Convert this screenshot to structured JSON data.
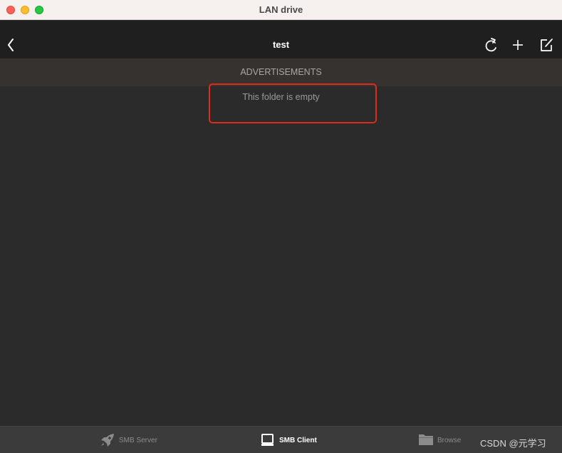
{
  "window": {
    "title": "LAN drive",
    "controls": [
      "close",
      "minimize",
      "maximize"
    ]
  },
  "navbar": {
    "title": "test",
    "back_icon": "chevron-left-icon",
    "actions": [
      {
        "name": "refresh",
        "icon": "refresh-icon"
      },
      {
        "name": "add",
        "icon": "plus-icon"
      },
      {
        "name": "edit",
        "icon": "compose-icon"
      }
    ]
  },
  "ad": {
    "label": "ADVERTISEMENTS"
  },
  "content": {
    "empty_message": "This folder is empty",
    "highlight_color": "#e02a1c"
  },
  "tabbar": {
    "tabs": [
      {
        "label": "SMB Server",
        "icon": "rocket-icon",
        "selected": false
      },
      {
        "label": "SMB Client",
        "icon": "monitor-icon",
        "selected": true
      },
      {
        "label": "Browse",
        "icon": "folder-icon",
        "selected": false
      }
    ]
  },
  "watermark": {
    "text": "CSDN @元学习"
  },
  "colors": {
    "background": "#2b2b2b",
    "navbar": "#1f1f1f",
    "tabbar": "#3b3b3b",
    "selected_tab": "#ffffff",
    "unselected_tab": "#8c8c8c"
  }
}
